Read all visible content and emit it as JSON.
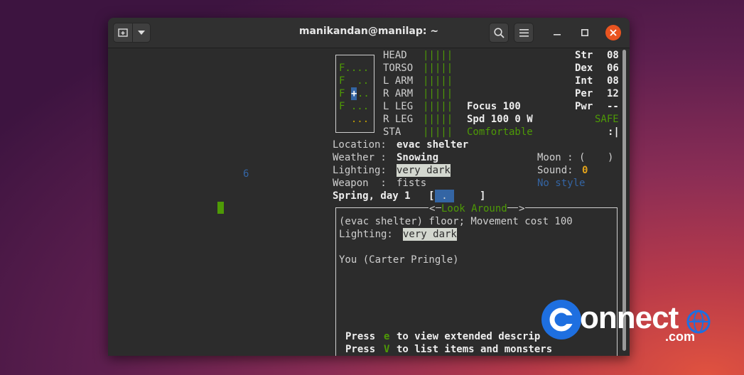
{
  "window": {
    "title": "manikandan@manilap: ~"
  },
  "hud": {
    "body_parts": [
      {
        "part": "HEAD",
        "bar": "|||||"
      },
      {
        "part": "TORSO",
        "bar": "|||||"
      },
      {
        "part": "L ARM",
        "bar": "|||||"
      },
      {
        "part": "R ARM",
        "bar": "|||||"
      },
      {
        "part": "L LEG",
        "bar": "|||||"
      },
      {
        "part": "R LEG",
        "bar": "|||||"
      },
      {
        "part": "STA",
        "bar": "|||||"
      }
    ],
    "minimap": [
      "F....",
      "F  ..",
      "F ",
      "+",
      "..",
      "F ...",
      "  ..."
    ],
    "stats": [
      {
        "name": "Str",
        "value": "08"
      },
      {
        "name": "Dex",
        "value": "06"
      },
      {
        "name": "Int",
        "value": "08"
      },
      {
        "name": "Per",
        "value": "12"
      },
      {
        "name": "Pwr",
        "value": "--"
      }
    ],
    "focus": "Focus 100",
    "speed": "Spd 100 0 W",
    "comfort": "Comfortable",
    "safe": "SAFE",
    "cursor": ":|",
    "location_label": "Location:",
    "location_value": "evac shelter",
    "weather_label": "Weather :",
    "weather_value": "Snowing",
    "lighting_label": "Lighting:",
    "lighting_value": "very dark",
    "weapon_label": "Weapon  :",
    "weapon_value": "fists",
    "date": "Spring, day 1",
    "date_bracket_open": "[",
    "date_indicator": ".",
    "date_bracket_close": "]",
    "moon_label": "Moon : (",
    "moon_close": ")",
    "sound_label": "Sound:",
    "sound_value": "0",
    "style": "No style"
  },
  "map": {
    "number_marker": "6"
  },
  "look_around": {
    "title_left": "<",
    "title": "Look Around",
    "title_right": ">",
    "line1": "(evac shelter) floor; Movement cost 100",
    "lighting_label": "Lighting:",
    "lighting_value": "very dark",
    "player": "You (Carter Pringle)",
    "press1_a": "Press",
    "press1_key": "e",
    "press1_b": "to view extended descrip",
    "press2_a": "Press",
    "press2_key": "V",
    "press2_b": "to list items and monsters"
  },
  "watermark": {
    "brand": "onnect",
    "suffix": ".com",
    "www": "www"
  },
  "colors": {
    "accent": "#e95420",
    "green": "#4e9a06",
    "yellow": "#c4a000",
    "blue": "#3465a4"
  }
}
